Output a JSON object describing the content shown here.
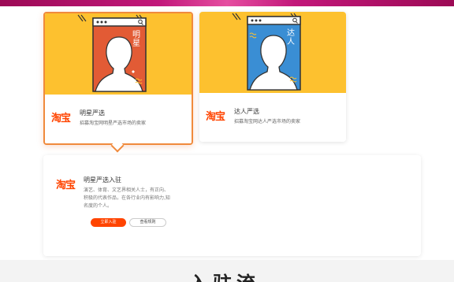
{
  "colors": {
    "accent": "#ff4400",
    "card_art_yellow": "#fdc12f",
    "selected_border": "#f08a3c",
    "star_panel": "#e25b35",
    "talent_panel": "#3a8ed4"
  },
  "cards": [
    {
      "logo": "淘宝",
      "title": "明星严选",
      "description": "招募淘宝网明星严选市场的卖家",
      "badge": "明星",
      "selected": true
    },
    {
      "logo": "淘宝",
      "title": "达人严选",
      "description": "招募淘宝网达人严选市场的卖家",
      "badge": "达人",
      "selected": false
    }
  ],
  "detail": {
    "logo": "淘宝",
    "title": "明星严选入驻",
    "description": "演艺、体育、文艺界相关人士，有正向、积极的代表作品，在各行业内有影响力,知名度的个人。",
    "primary_button": "立即入驻",
    "secondary_button": "查看规则"
  },
  "section_heading": "入驻流程"
}
